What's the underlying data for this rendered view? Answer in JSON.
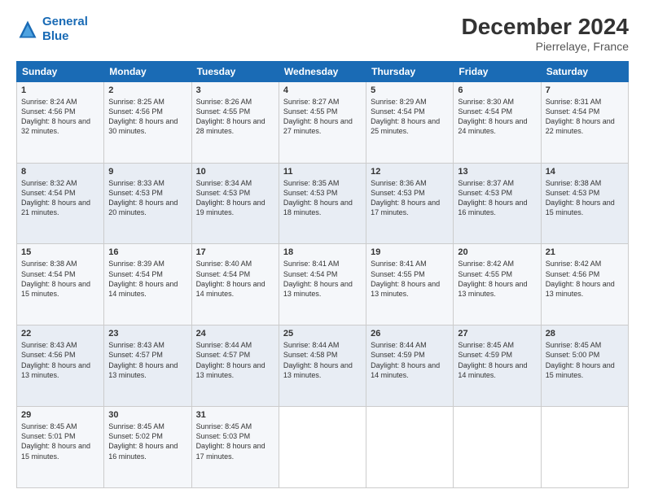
{
  "header": {
    "logo_line1": "General",
    "logo_line2": "Blue",
    "title": "December 2024",
    "subtitle": "Pierrelaye, France"
  },
  "days_of_week": [
    "Sunday",
    "Monday",
    "Tuesday",
    "Wednesday",
    "Thursday",
    "Friday",
    "Saturday"
  ],
  "weeks": [
    [
      {
        "day": "1",
        "sunrise": "8:24 AM",
        "sunset": "4:56 PM",
        "daylight": "8 hours and 32 minutes."
      },
      {
        "day": "2",
        "sunrise": "8:25 AM",
        "sunset": "4:56 PM",
        "daylight": "8 hours and 30 minutes."
      },
      {
        "day": "3",
        "sunrise": "8:26 AM",
        "sunset": "4:55 PM",
        "daylight": "8 hours and 28 minutes."
      },
      {
        "day": "4",
        "sunrise": "8:27 AM",
        "sunset": "4:55 PM",
        "daylight": "8 hours and 27 minutes."
      },
      {
        "day": "5",
        "sunrise": "8:29 AM",
        "sunset": "4:54 PM",
        "daylight": "8 hours and 25 minutes."
      },
      {
        "day": "6",
        "sunrise": "8:30 AM",
        "sunset": "4:54 PM",
        "daylight": "8 hours and 24 minutes."
      },
      {
        "day": "7",
        "sunrise": "8:31 AM",
        "sunset": "4:54 PM",
        "daylight": "8 hours and 22 minutes."
      }
    ],
    [
      {
        "day": "8",
        "sunrise": "8:32 AM",
        "sunset": "4:54 PM",
        "daylight": "8 hours and 21 minutes."
      },
      {
        "day": "9",
        "sunrise": "8:33 AM",
        "sunset": "4:53 PM",
        "daylight": "8 hours and 20 minutes."
      },
      {
        "day": "10",
        "sunrise": "8:34 AM",
        "sunset": "4:53 PM",
        "daylight": "8 hours and 19 minutes."
      },
      {
        "day": "11",
        "sunrise": "8:35 AM",
        "sunset": "4:53 PM",
        "daylight": "8 hours and 18 minutes."
      },
      {
        "day": "12",
        "sunrise": "8:36 AM",
        "sunset": "4:53 PM",
        "daylight": "8 hours and 17 minutes."
      },
      {
        "day": "13",
        "sunrise": "8:37 AM",
        "sunset": "4:53 PM",
        "daylight": "8 hours and 16 minutes."
      },
      {
        "day": "14",
        "sunrise": "8:38 AM",
        "sunset": "4:53 PM",
        "daylight": "8 hours and 15 minutes."
      }
    ],
    [
      {
        "day": "15",
        "sunrise": "8:38 AM",
        "sunset": "4:54 PM",
        "daylight": "8 hours and 15 minutes."
      },
      {
        "day": "16",
        "sunrise": "8:39 AM",
        "sunset": "4:54 PM",
        "daylight": "8 hours and 14 minutes."
      },
      {
        "day": "17",
        "sunrise": "8:40 AM",
        "sunset": "4:54 PM",
        "daylight": "8 hours and 14 minutes."
      },
      {
        "day": "18",
        "sunrise": "8:41 AM",
        "sunset": "4:54 PM",
        "daylight": "8 hours and 13 minutes."
      },
      {
        "day": "19",
        "sunrise": "8:41 AM",
        "sunset": "4:55 PM",
        "daylight": "8 hours and 13 minutes."
      },
      {
        "day": "20",
        "sunrise": "8:42 AM",
        "sunset": "4:55 PM",
        "daylight": "8 hours and 13 minutes."
      },
      {
        "day": "21",
        "sunrise": "8:42 AM",
        "sunset": "4:56 PM",
        "daylight": "8 hours and 13 minutes."
      }
    ],
    [
      {
        "day": "22",
        "sunrise": "8:43 AM",
        "sunset": "4:56 PM",
        "daylight": "8 hours and 13 minutes."
      },
      {
        "day": "23",
        "sunrise": "8:43 AM",
        "sunset": "4:57 PM",
        "daylight": "8 hours and 13 minutes."
      },
      {
        "day": "24",
        "sunrise": "8:44 AM",
        "sunset": "4:57 PM",
        "daylight": "8 hours and 13 minutes."
      },
      {
        "day": "25",
        "sunrise": "8:44 AM",
        "sunset": "4:58 PM",
        "daylight": "8 hours and 13 minutes."
      },
      {
        "day": "26",
        "sunrise": "8:44 AM",
        "sunset": "4:59 PM",
        "daylight": "8 hours and 14 minutes."
      },
      {
        "day": "27",
        "sunrise": "8:45 AM",
        "sunset": "4:59 PM",
        "daylight": "8 hours and 14 minutes."
      },
      {
        "day": "28",
        "sunrise": "8:45 AM",
        "sunset": "5:00 PM",
        "daylight": "8 hours and 15 minutes."
      }
    ],
    [
      {
        "day": "29",
        "sunrise": "8:45 AM",
        "sunset": "5:01 PM",
        "daylight": "8 hours and 15 minutes."
      },
      {
        "day": "30",
        "sunrise": "8:45 AM",
        "sunset": "5:02 PM",
        "daylight": "8 hours and 16 minutes."
      },
      {
        "day": "31",
        "sunrise": "8:45 AM",
        "sunset": "5:03 PM",
        "daylight": "8 hours and 17 minutes."
      },
      null,
      null,
      null,
      null
    ]
  ],
  "labels": {
    "sunrise": "Sunrise:",
    "sunset": "Sunset:",
    "daylight": "Daylight:"
  }
}
